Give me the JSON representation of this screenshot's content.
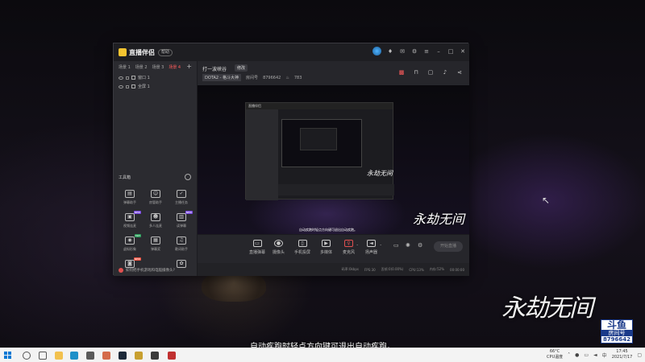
{
  "app": {
    "name": "直播伴侣",
    "badge": "帮助",
    "scene_tabs": [
      "场景 1",
      "场景 2",
      "场景 3",
      "场景 4"
    ],
    "active_scene_index": 3,
    "sources": [
      "窗口 1",
      "全屏 1"
    ],
    "tools_header": "工具箱",
    "tools": [
      {
        "label": "弹幕助手",
        "icon": "danmu-icon",
        "tag": ""
      },
      {
        "label": "房管助手",
        "icon": "admin-icon",
        "tag": ""
      },
      {
        "label": "主播任务",
        "icon": "task-icon",
        "tag": ""
      },
      {
        "label": "视频连麦",
        "icon": "video-link-icon",
        "tag": "NEW"
      },
      {
        "label": "多人连麦",
        "icon": "multi-link-icon",
        "tag": ""
      },
      {
        "label": "读弹幕",
        "icon": "read-danmu-icon",
        "tag": "NEW"
      },
      {
        "label": "虚拟形象",
        "icon": "avatar-icon",
        "tag": "HOT"
      },
      {
        "label": "弹幕奖",
        "icon": "danmu-prize-icon",
        "tag": ""
      },
      {
        "label": "歌词助手",
        "icon": "lyrics-icon",
        "tag": ""
      },
      {
        "label": "",
        "icon": "camera-icon",
        "tag": "NEW"
      },
      {
        "label": "",
        "icon": "blank",
        "tag": ""
      },
      {
        "label": "",
        "icon": "gift-icon",
        "tag": ""
      }
    ],
    "footer_text": "如何把手机游戏和电脑摄像头?"
  },
  "room": {
    "title": "打一波峡谷",
    "edit_label": "修改",
    "category": "DOTA2 - 格斗大神",
    "id_label": "房间号",
    "room_id": "8796642",
    "heat": "783"
  },
  "controls": [
    {
      "label": "直播弹幕",
      "icon": "danmu-screen-icon"
    },
    {
      "label": "摄像头",
      "icon": "camera-icon"
    },
    {
      "label": "手机投屏",
      "icon": "phone-cast-icon"
    },
    {
      "label": "多媒体",
      "icon": "media-icon"
    },
    {
      "label": "麦克风",
      "icon": "mic-icon"
    },
    {
      "label": "扬声器",
      "icon": "speaker-icon"
    }
  ],
  "start_button": "开始直播",
  "status_bar": [
    "码率:0kbps",
    "FPS:30",
    "丢帧:0(0.00%)",
    "CPU:13%",
    "内存:52%",
    "00:00:00"
  ],
  "preview": {
    "caption": "自动疾跑时轻点方向键可退出自动疾跑。",
    "watermark": "永劫无间",
    "nested_app_name": "直播伴侣"
  },
  "overlay": {
    "game_logo": "永劫无间",
    "douyu_top": "斗鱼",
    "douyu_label": "房间号",
    "douyu_number": "8796642",
    "subtitle": "自动疾跑时轻点方向键可退出自动疾跑。"
  },
  "taskbar": {
    "weather": "66°C",
    "weather_sub": "CPU温度",
    "time": "17:45",
    "date": "2021/7/17",
    "lang": "中",
    "apps": [
      {
        "icon": "file-explorer-icon",
        "color": "#f2c14e"
      },
      {
        "icon": "edge-icon",
        "color": "#1e90c8"
      },
      {
        "icon": "store-icon",
        "color": "#5a5a5a"
      },
      {
        "icon": "app-icon",
        "color": "#d46b4a"
      },
      {
        "icon": "steam-icon",
        "color": "#1b2838"
      },
      {
        "icon": "game-icon",
        "color": "#c8a030"
      },
      {
        "icon": "app-icon-2",
        "color": "#3a3a3a"
      },
      {
        "icon": "live-companion-icon",
        "color": "#c03030"
      }
    ]
  }
}
